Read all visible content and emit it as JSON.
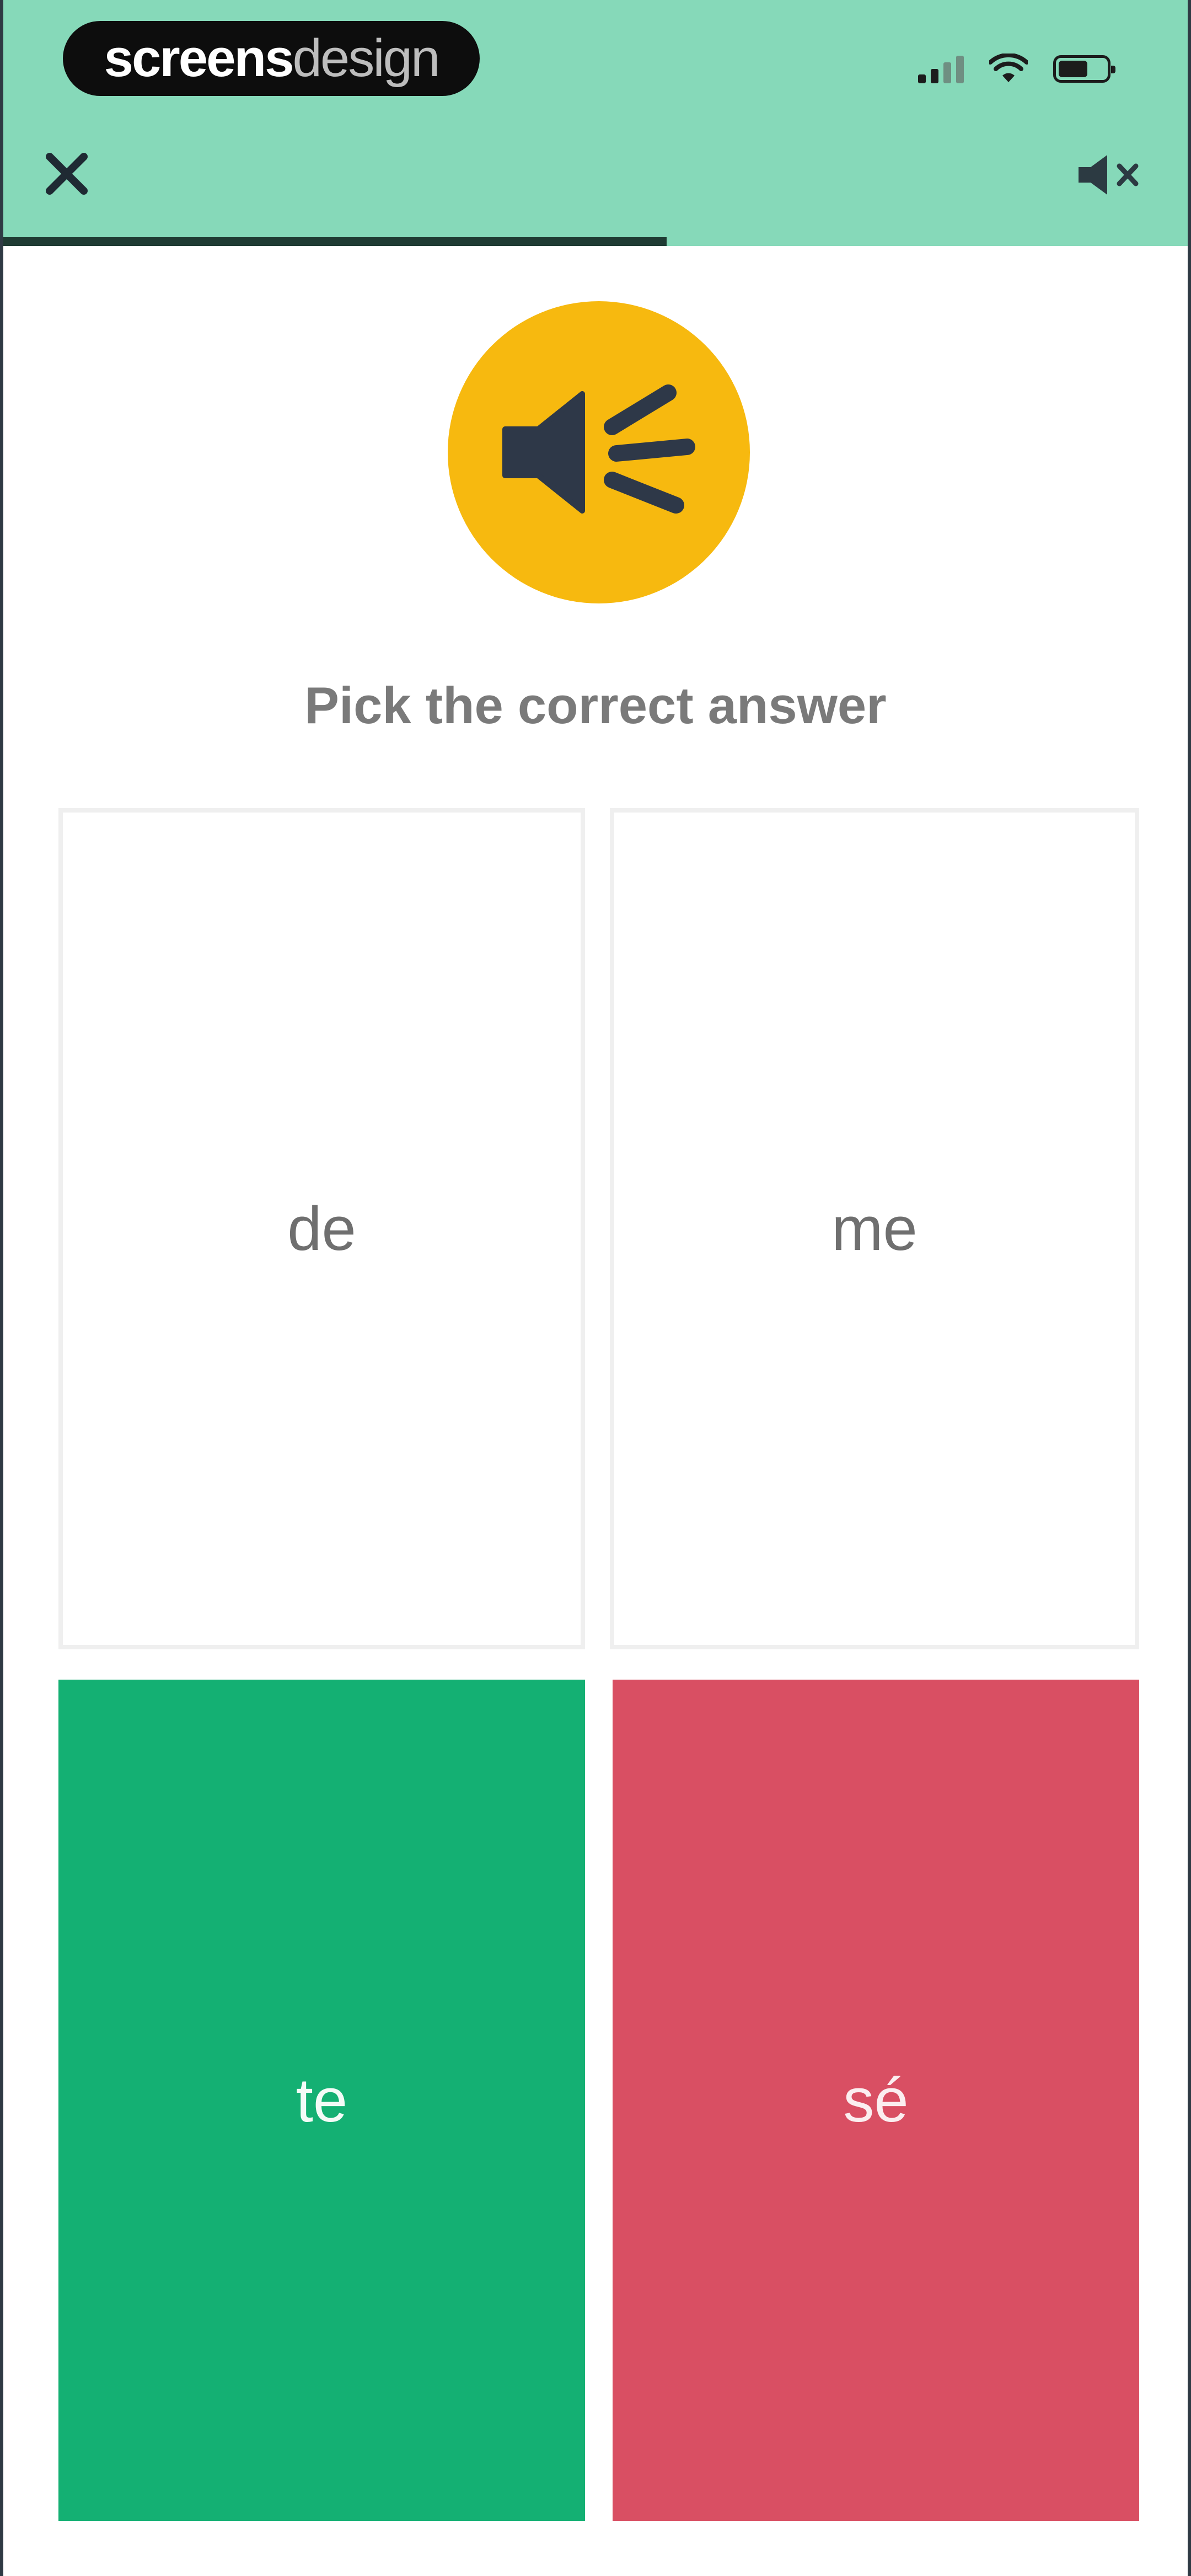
{
  "watermark": {
    "bold": "screens",
    "light": "design"
  },
  "header": {
    "close_icon": "close-icon",
    "mute_icon": "speaker-muted-icon",
    "progress": 0.56,
    "colors": {
      "header_bg": "#86d9b9",
      "progress_fill": "#1f3b33"
    }
  },
  "audio": {
    "icon": "speaker-loud-icon",
    "color": "#f7b90f"
  },
  "prompt": "Pick the correct answer",
  "answers": [
    {
      "label": "de",
      "state": "neutral"
    },
    {
      "label": "me",
      "state": "neutral"
    },
    {
      "label": "te",
      "state": "correct",
      "color": "#14b073"
    },
    {
      "label": "sé",
      "state": "wrong",
      "color": "#d94f63"
    }
  ]
}
